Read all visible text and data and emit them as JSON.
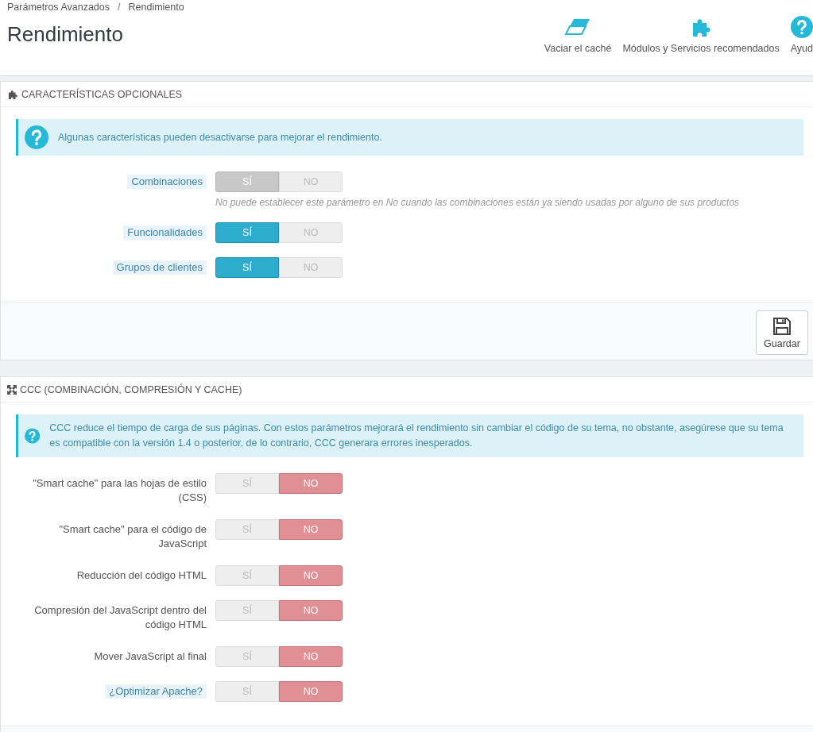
{
  "breadcrumb": [
    "Parámetros Avanzados",
    "Rendimiento"
  ],
  "breadcrumb_separator": "/",
  "title": "Rendimiento",
  "toolbar": [
    {
      "kind": "eraser",
      "label": "Vaciar el caché"
    },
    {
      "kind": "puzzle",
      "label": "Módulos y Servicios recomendados"
    },
    {
      "kind": "help",
      "label": "Ayud"
    }
  ],
  "panels": [
    {
      "kind": "puzzle",
      "title": "CARACTERÍSTICAS OPCIONALES",
      "info": "Algunas características pueden desactivarse para mejorar el rendimiento.",
      "rows": [
        {
          "label": "Combinaciones",
          "has_help": true,
          "yes": "SÍ",
          "no": "NO",
          "on": true,
          "disabled": true,
          "note": "No puede establecer este parámetro en No cuando las combinaciones están ya siendo usadas por alguno de sus productos"
        },
        {
          "label": "Funcionalidades",
          "has_help": true,
          "yes": "SÍ",
          "no": "NO",
          "on": true,
          "disabled": false
        },
        {
          "label": "Grupos de clientes",
          "has_help": true,
          "yes": "SÍ",
          "no": "NO",
          "on": true,
          "disabled": false
        }
      ],
      "save": "Guardar"
    },
    {
      "kind": "arrows",
      "title": "CCC (COMBINACIÓN, COMPRESIÓN Y CACHE)",
      "info": "CCC reduce el tiempo de carga de sus páginas. Con estos parámetros mejorará el rendimiento sin cambiar el código de su tema, no obstante, asegúrese que su tema es compatible con la versión 1.4 o posterior, de lo contrario, CCC generara errores inesperados.",
      "rows": [
        {
          "label": "\"Smart cache\" para las hojas de estilo (CSS)",
          "has_help": false,
          "yes": "SÍ",
          "no": "NO",
          "on": false,
          "disabled": false
        },
        {
          "label": "\"Smart cache\" para el código de JavaScript",
          "has_help": false,
          "yes": "SÍ",
          "no": "NO",
          "on": false,
          "disabled": false
        },
        {
          "label": "Reducción del código HTML",
          "has_help": false,
          "yes": "SÍ",
          "no": "NO",
          "on": false,
          "disabled": false
        },
        {
          "label": "Compresión del JavaScript dentro del código HTML",
          "has_help": false,
          "yes": "SÍ",
          "no": "NO",
          "on": false,
          "disabled": false
        },
        {
          "label": "Mover JavaScript al final",
          "has_help": false,
          "yes": "SÍ",
          "no": "NO",
          "on": false,
          "disabled": false
        },
        {
          "label": "¿Optimizar Apache?",
          "has_help": true,
          "yes": "SÍ",
          "no": "NO",
          "on": false,
          "disabled": false
        }
      ]
    }
  ]
}
